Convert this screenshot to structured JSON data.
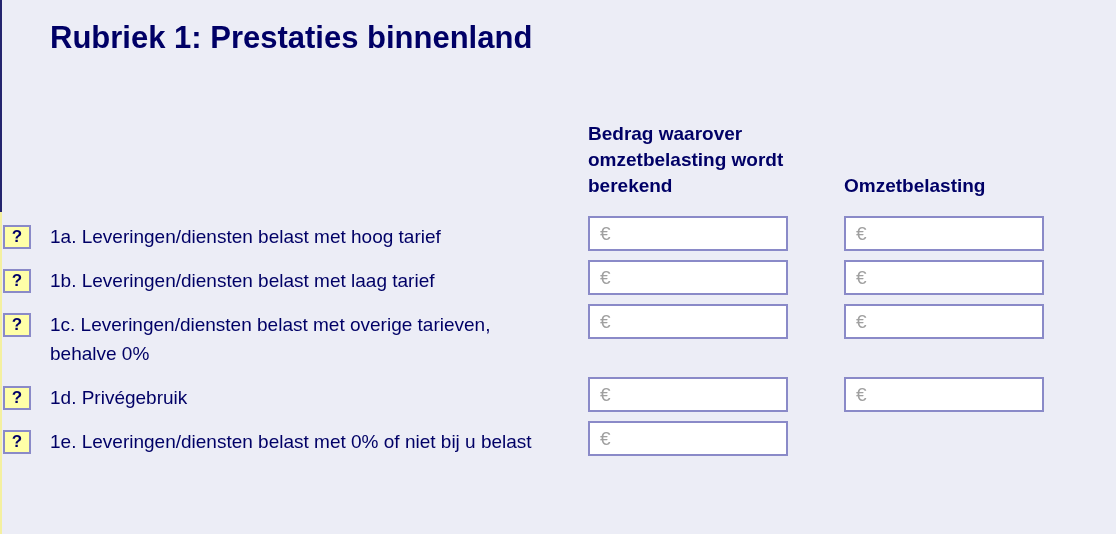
{
  "title": "Rubriek 1: Prestaties binnenland",
  "columns": [
    {
      "label": "Bedrag waarover omzetbelasting wordt berekend"
    },
    {
      "label": "Omzetbelasting"
    }
  ],
  "rows": [
    {
      "help": "?",
      "label": "1a. Leveringen/diensten belast met hoog tarief",
      "fields": [
        {
          "placeholder": "€"
        },
        {
          "placeholder": "€"
        }
      ]
    },
    {
      "help": "?",
      "label": "1b. Leveringen/diensten belast met laag tarief",
      "fields": [
        {
          "placeholder": "€"
        },
        {
          "placeholder": "€"
        }
      ]
    },
    {
      "help": "?",
      "label": "1c. Leveringen/diensten belast met overige tarieven, behalve 0%",
      "fields": [
        {
          "placeholder": "€"
        },
        {
          "placeholder": "€"
        }
      ]
    },
    {
      "help": "?",
      "label": "1d. Privégebruik",
      "fields": [
        {
          "placeholder": "€"
        },
        {
          "placeholder": "€"
        }
      ]
    },
    {
      "help": "?",
      "label": "1e. Leveringen/diensten belast met 0% of niet bij u belast",
      "fields": [
        {
          "placeholder": "€"
        }
      ]
    }
  ]
}
